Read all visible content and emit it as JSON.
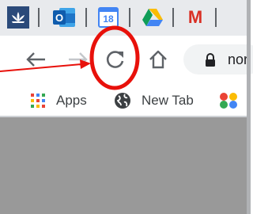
{
  "tabs": {
    "pinned": [
      {
        "icon": "lotus-icon"
      },
      {
        "icon": "outlook-icon"
      },
      {
        "icon": "calendar-icon",
        "label": "18"
      },
      {
        "icon": "drive-icon"
      },
      {
        "icon": "gmail-icon",
        "label": "M"
      }
    ]
  },
  "toolbar": {
    "back_icon": "back-arrow-icon",
    "forward_icon": "forward-arrow-icon",
    "reload_icon": "reload-icon",
    "home_icon": "home-icon",
    "omnibox_text": "nor",
    "lock_icon": "lock-icon"
  },
  "bookmarks": [
    {
      "icon": "apps-grid-icon",
      "label": "Apps"
    },
    {
      "icon": "globe-icon",
      "label": "New Tab"
    },
    {
      "icon": "colored-dots-icon",
      "label": ""
    }
  ],
  "annotation": {
    "type": "red circle with arrow",
    "target": "reload-icon",
    "color": "#e8110b"
  },
  "colors": {
    "tabstrip": "#e8eaed",
    "content_area": "#999999",
    "icon_gray": "#5f6368"
  }
}
